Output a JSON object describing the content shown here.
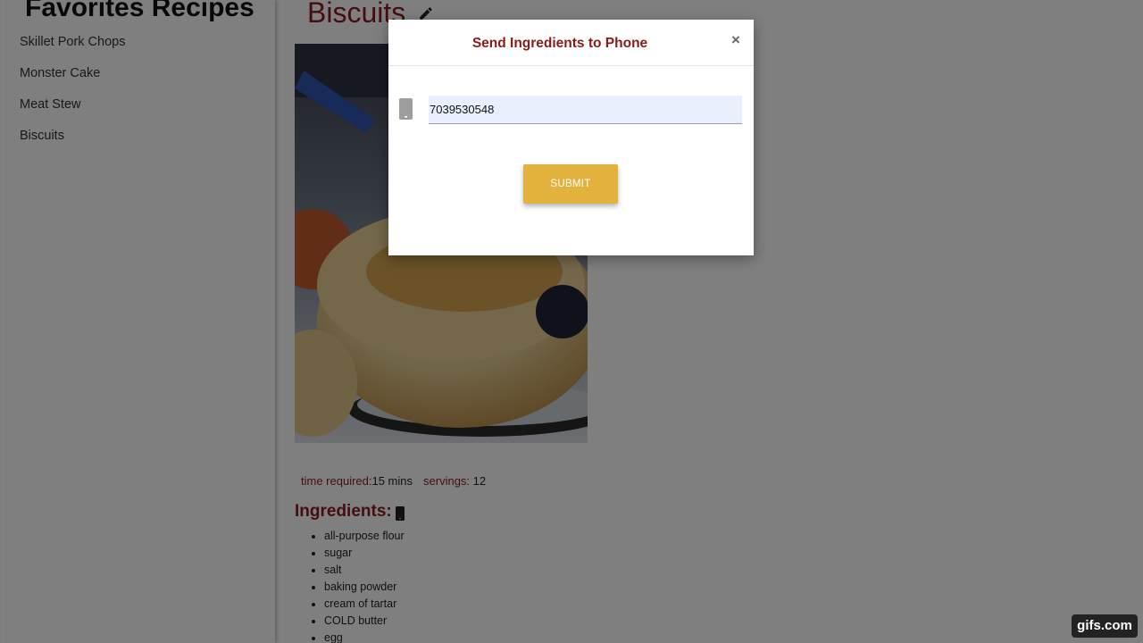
{
  "sidebar": {
    "title": "Favorites Recipes",
    "items": [
      "Skillet Pork Chops",
      "Monster Cake",
      "Meat Stew",
      "Biscuits"
    ]
  },
  "recipe": {
    "title": "Biscuits",
    "time_label": "time required:",
    "time_value": "15 mins",
    "servings_label": "servings:",
    "servings_value": "12",
    "ingredients_heading": "Ingredients:",
    "ingredients": [
      "all-purpose flour",
      "sugar",
      "salt",
      "baking powder",
      "cream of tartar",
      "COLD butter",
      "egg"
    ]
  },
  "modal": {
    "title": "Send Ingredients to Phone",
    "close_symbol": "×",
    "phone_value": "7039530548",
    "submit_label": "SUBMIT"
  },
  "watermark": "gifs.com",
  "colors": {
    "accent": "#8b1a1a",
    "submit": "#e3b23c",
    "input_bg": "#e8f0fe"
  },
  "icons": [
    "edit-icon",
    "phone-icon",
    "close-icon"
  ]
}
